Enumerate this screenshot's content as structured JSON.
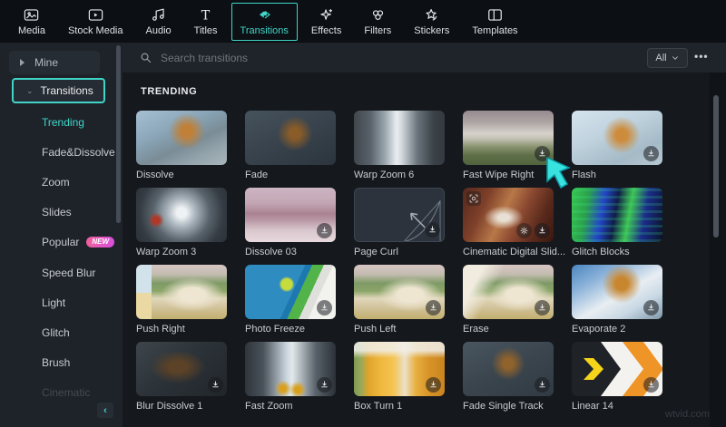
{
  "topbar": {
    "items": [
      {
        "label": "Media",
        "icon": "media-icon",
        "active": false
      },
      {
        "label": "Stock Media",
        "icon": "stock-media-icon",
        "active": false
      },
      {
        "label": "Audio",
        "icon": "audio-icon",
        "active": false
      },
      {
        "label": "Titles",
        "icon": "titles-icon",
        "active": false
      },
      {
        "label": "Transitions",
        "icon": "transitions-icon",
        "active": true
      },
      {
        "label": "Effects",
        "icon": "effects-icon",
        "active": false
      },
      {
        "label": "Filters",
        "icon": "filters-icon",
        "active": false
      },
      {
        "label": "Stickers",
        "icon": "stickers-icon",
        "active": false
      },
      {
        "label": "Templates",
        "icon": "templates-icon",
        "active": false
      }
    ]
  },
  "sidebar": {
    "mine_label": "Mine",
    "transitions_label": "Transitions",
    "categories": [
      {
        "label": "Trending",
        "selected": true
      },
      {
        "label": "Fade&Dissolve"
      },
      {
        "label": "Zoom"
      },
      {
        "label": "Slides"
      },
      {
        "label": "Popular",
        "badge": "NEW"
      },
      {
        "label": "Speed Blur"
      },
      {
        "label": "Light"
      },
      {
        "label": "Glitch"
      },
      {
        "label": "Brush"
      },
      {
        "label": "Cinematic",
        "faded": true
      }
    ]
  },
  "search": {
    "placeholder": "Search transitions",
    "filter_label": "All",
    "more_label": "•••"
  },
  "section_title": "TRENDING",
  "grid": {
    "items": [
      {
        "name": "Dissolve",
        "art": "snow-bright",
        "download": false
      },
      {
        "name": "Fade",
        "art": "snow-dark",
        "download": false
      },
      {
        "name": "Warp Zoom 6",
        "art": "city-warp",
        "download": false
      },
      {
        "name": "Fast Wipe Right",
        "art": "wipe-right",
        "download": true
      },
      {
        "name": "Flash",
        "art": "snow-flash",
        "download": true
      },
      {
        "name": "Warp Zoom 3",
        "art": "city-burst",
        "download": false
      },
      {
        "name": "Dissolve 03",
        "art": "pink-mountain",
        "download": true
      },
      {
        "name": "Page Curl",
        "art": "page-curl",
        "download": true
      },
      {
        "name": "Cinematic Digital Slid...",
        "art": "cinematic",
        "download": true,
        "gear": true,
        "ai_badge": true
      },
      {
        "name": "Glitch Blocks",
        "art": "glitch",
        "download": false
      },
      {
        "name": "Push Right",
        "art": "house-strip",
        "download": false
      },
      {
        "name": "Photo Freeze",
        "art": "photo-freeze",
        "download": true
      },
      {
        "name": "Push Left",
        "art": "house",
        "download": true
      },
      {
        "name": "Erase",
        "art": "house-erase",
        "download": true
      },
      {
        "name": "Evaporate 2",
        "art": "evaporate",
        "download": true
      },
      {
        "name": "Blur Dissolve 1",
        "art": "blur-dark",
        "download": true
      },
      {
        "name": "Fast Zoom",
        "art": "city-fast",
        "download": true
      },
      {
        "name": "Box Turn 1",
        "art": "van-blur",
        "download": true
      },
      {
        "name": "Fade Single Track",
        "art": "snow-dark2",
        "download": true
      },
      {
        "name": "Linear 14",
        "art": "linear14",
        "download": true
      }
    ]
  },
  "watermark": "wtvid.com"
}
